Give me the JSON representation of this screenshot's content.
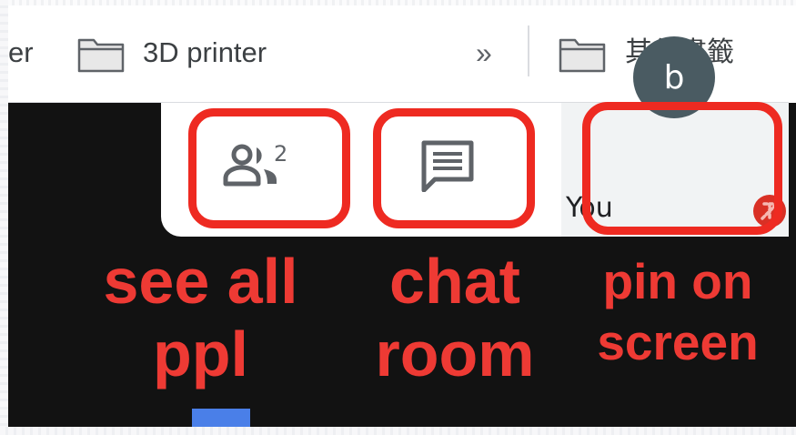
{
  "bookmarks_bar": {
    "truncated_item_label": "er",
    "items": [
      {
        "label": "3D printer",
        "icon": "folder-icon"
      },
      {
        "label": "其他書籤",
        "icon": "folder-icon"
      }
    ],
    "overflow_label": "»"
  },
  "meeting_controls": {
    "participant_count": "2",
    "people_icon": "people-icon",
    "chat_icon": "chat-icon",
    "self_tile": {
      "avatar_letter": "b",
      "name_label": "You"
    }
  },
  "annotations": {
    "people": [
      "see all",
      "ppl"
    ],
    "chat": [
      "chat",
      "room"
    ],
    "pin": [
      "pin on",
      "screen"
    ]
  },
  "colors": {
    "annotation_red": "#ee2a21",
    "avatar_bg": "#4a5b62",
    "icon_gray": "#5f6368",
    "meeting_bg": "#121212",
    "accent_blue": "#4a7fe8"
  }
}
